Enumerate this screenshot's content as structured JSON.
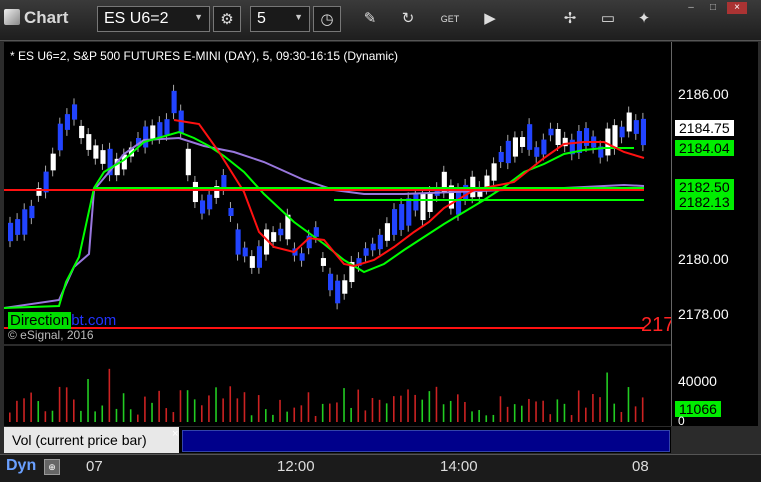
{
  "window": {
    "title": "Chart",
    "symbol": "ES U6=2",
    "interval": "5",
    "controls": [
      "–",
      "□",
      "×"
    ]
  },
  "toolbar_icons": [
    "gear-icon",
    "clock-icon",
    "pencil-icon",
    "refresh-icon",
    "get-icon",
    "play-icon",
    "tools-icon",
    "comment-icon",
    "twitter-icon"
  ],
  "chart": {
    "header": "* ES U6=2, S&P 500 FUTURES E-MINI (DAY), 5, 09:30-16:15 (Dynamic)",
    "copyright": "© eSignal, 2016",
    "watermark_a": "Direction",
    "watermark_b": "bt.com",
    "red_line_label": "217",
    "colors": {
      "up": "#ffffff",
      "down": "#2244ff",
      "green": "#00ff00",
      "red": "#ff1111",
      "purple": "#aa88ee"
    }
  },
  "price_axis": {
    "ticks": [
      "2186.00",
      "2180.00",
      "2178.00"
    ],
    "badges": {
      "current": "2184.75",
      "green_ma": "2184.04",
      "lower_1": "2182.50",
      "lower_2": "2182.13"
    }
  },
  "volume": {
    "label": "Vol (current price bar)",
    "tick_40000": "40000",
    "tick_0": "0",
    "current": "11066"
  },
  "time_axis": {
    "labels": [
      "07",
      "12:00",
      "14:00",
      "08"
    ]
  },
  "status": {
    "mode": "Dyn"
  },
  "chart_data": {
    "type": "line",
    "title": "* ES U6=2, S&P 500 FUTURES E-MINI (DAY), 5, 09:30-16:15 (Dynamic)",
    "x": [
      "07",
      "12:00",
      "14:00",
      "08"
    ],
    "series": [],
    "ylim": [
      2177.5,
      2187.5
    ],
    "grid": false,
    "legend": "none"
  }
}
